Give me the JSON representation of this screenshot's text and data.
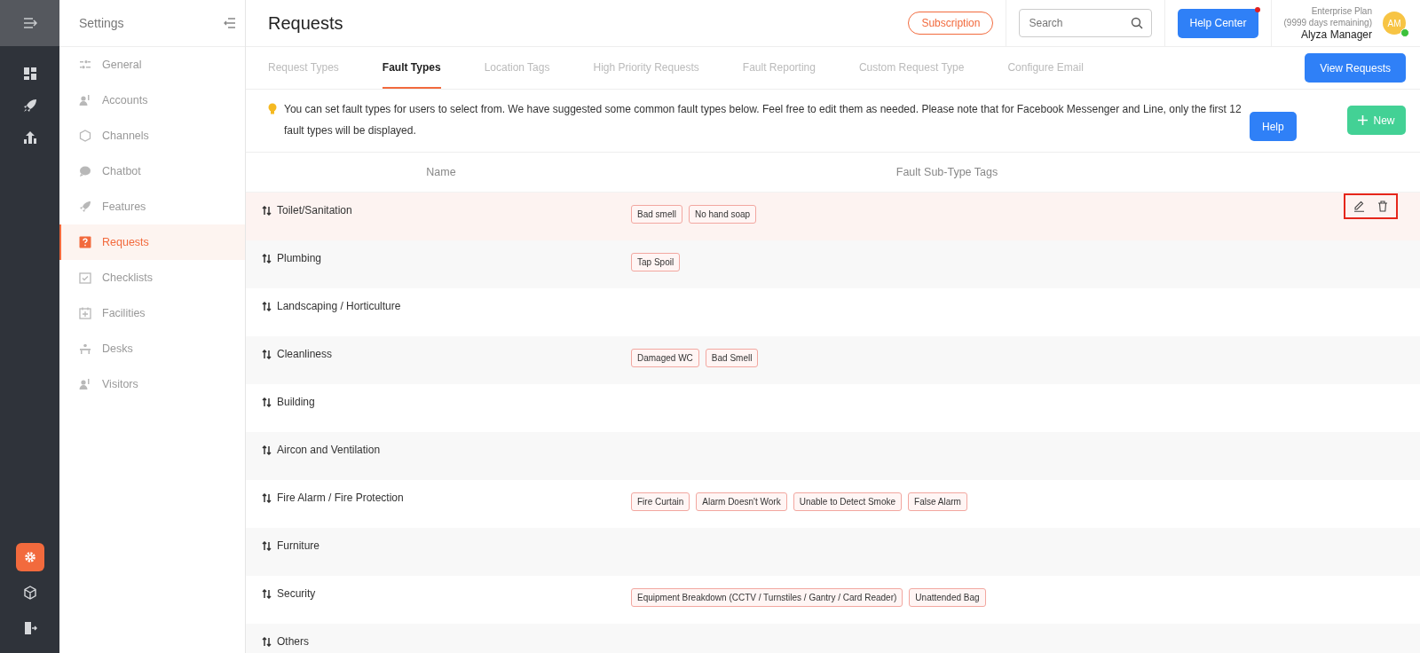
{
  "rail": {
    "bottom_items": [
      {
        "selected": true
      },
      {
        "selected": false
      },
      {
        "selected": false
      }
    ]
  },
  "sidebar": {
    "title": "Settings",
    "items": [
      {
        "label": "General",
        "selected": false
      },
      {
        "label": "Accounts",
        "selected": false
      },
      {
        "label": "Channels",
        "selected": false
      },
      {
        "label": "Chatbot",
        "selected": false
      },
      {
        "label": "Features",
        "selected": false
      },
      {
        "label": "Requests",
        "selected": true
      },
      {
        "label": "Checklists",
        "selected": false
      },
      {
        "label": "Facilities",
        "selected": false
      },
      {
        "label": "Desks",
        "selected": false
      },
      {
        "label": "Visitors",
        "selected": false
      }
    ]
  },
  "header": {
    "title": "Requests",
    "subscription": "Subscription",
    "search": {
      "placeholder": "Search"
    },
    "help_center": "Help Center",
    "notification": true,
    "plan": "Enterprise Plan",
    "remaining": "(9999 days remaining)",
    "user": "Alyza Manager",
    "avatar": "AM",
    "online": true
  },
  "tabs": [
    {
      "label": "Request Types",
      "selected": false
    },
    {
      "label": "Fault Types",
      "selected": true
    },
    {
      "label": "Location Tags",
      "selected": false
    },
    {
      "label": "High Priority Requests",
      "selected": false
    },
    {
      "label": "Fault Reporting",
      "selected": false
    },
    {
      "label": "Custom Request Type",
      "selected": false
    },
    {
      "label": "Configure Email",
      "selected": false
    }
  ],
  "view_requests": "View Requests",
  "notice": {
    "text": "You can set fault types for users to select from. We have suggested some common fault types below. Feel free to edit them as needed. Please note that for Facebook Messenger and Line, only the first 12 fault types will be displayed.",
    "help": "Help"
  },
  "new_button": "New",
  "table": {
    "columns": [
      "Name",
      "Fault Sub-Type Tags"
    ],
    "rows": [
      {
        "name": "Toilet/Sanitation",
        "tags": [
          "Bad smell",
          "No hand soap"
        ],
        "highlighted": true
      },
      {
        "name": "Plumbing",
        "tags": [
          "Tap Spoil"
        ],
        "highlighted": false
      },
      {
        "name": "Landscaping / Horticulture",
        "tags": [],
        "highlighted": false
      },
      {
        "name": "Cleanliness",
        "tags": [
          "Damaged WC",
          "Bad Smell"
        ],
        "highlighted": false
      },
      {
        "name": "Building",
        "tags": [],
        "highlighted": false
      },
      {
        "name": "Aircon and Ventilation",
        "tags": [],
        "highlighted": false
      },
      {
        "name": "Fire Alarm / Fire Protection",
        "tags": [
          "Fire Curtain",
          "Alarm Doesn't Work",
          "Unable to Detect Smoke",
          "False Alarm"
        ],
        "highlighted": false
      },
      {
        "name": "Furniture",
        "tags": [],
        "highlighted": false
      },
      {
        "name": "Security",
        "tags": [
          "Equipment Breakdown (CCTV / Turnstiles / Gantry / Card Reader)",
          "Unattended Bag"
        ],
        "highlighted": false
      },
      {
        "name": "Others",
        "tags": [],
        "highlighted": false
      }
    ]
  }
}
